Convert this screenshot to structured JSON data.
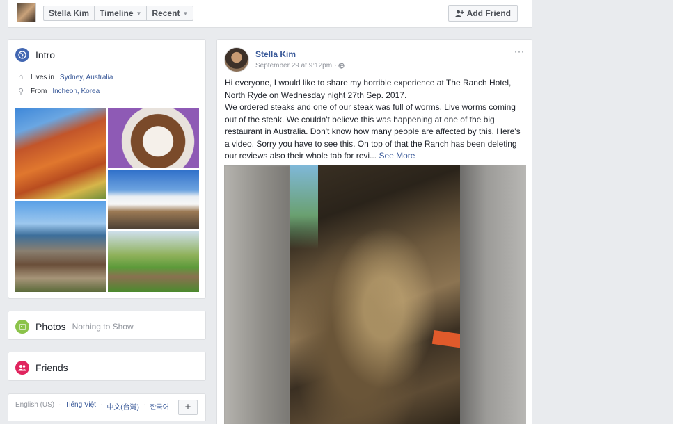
{
  "top_bar": {
    "name": "Stella Kim",
    "nav": [
      {
        "label": "Timeline",
        "has_caret": true
      },
      {
        "label": "Recent",
        "has_caret": true
      }
    ],
    "add_friend_label": "Add Friend"
  },
  "intro": {
    "title": "Intro",
    "lives_prefix": "Lives in",
    "lives_city": "Sydney, Australia",
    "from_prefix": "From",
    "from_city": "Incheon, Korea"
  },
  "photos": {
    "title": "Photos",
    "empty_text": "Nothing to Show"
  },
  "friends": {
    "title": "Friends"
  },
  "languages": {
    "current": "English (US)",
    "others": [
      "Tiếng Việt",
      "中文(台灣)",
      "한국어"
    ],
    "more_label": "+"
  },
  "post": {
    "author": "Stella Kim",
    "timestamp": "September 29 at 9:12pm",
    "more_label": "···",
    "text": "Hi everyone, I would like to share my horrible experience at The Ranch Hotel, North Ryde on Wednesday night 27th Sep. 2017.\nWe ordered steaks and one of our steak was full of worms. Live worms coming out of the steak. We couldn't believe this was happening at one of the big restaurant in Australia. Don't know how many people are affected by this. Here's a video. Sorry you have to see this. On top of that the Ranch has been deleting our reviews also their whole tab for revi...",
    "see_more_label": "See More"
  },
  "colors": {
    "link": "#385898",
    "background": "#e9ebee",
    "intro_icon": "#4267b2",
    "photos_icon": "#8bc34a",
    "friends_icon": "#e0245e"
  }
}
